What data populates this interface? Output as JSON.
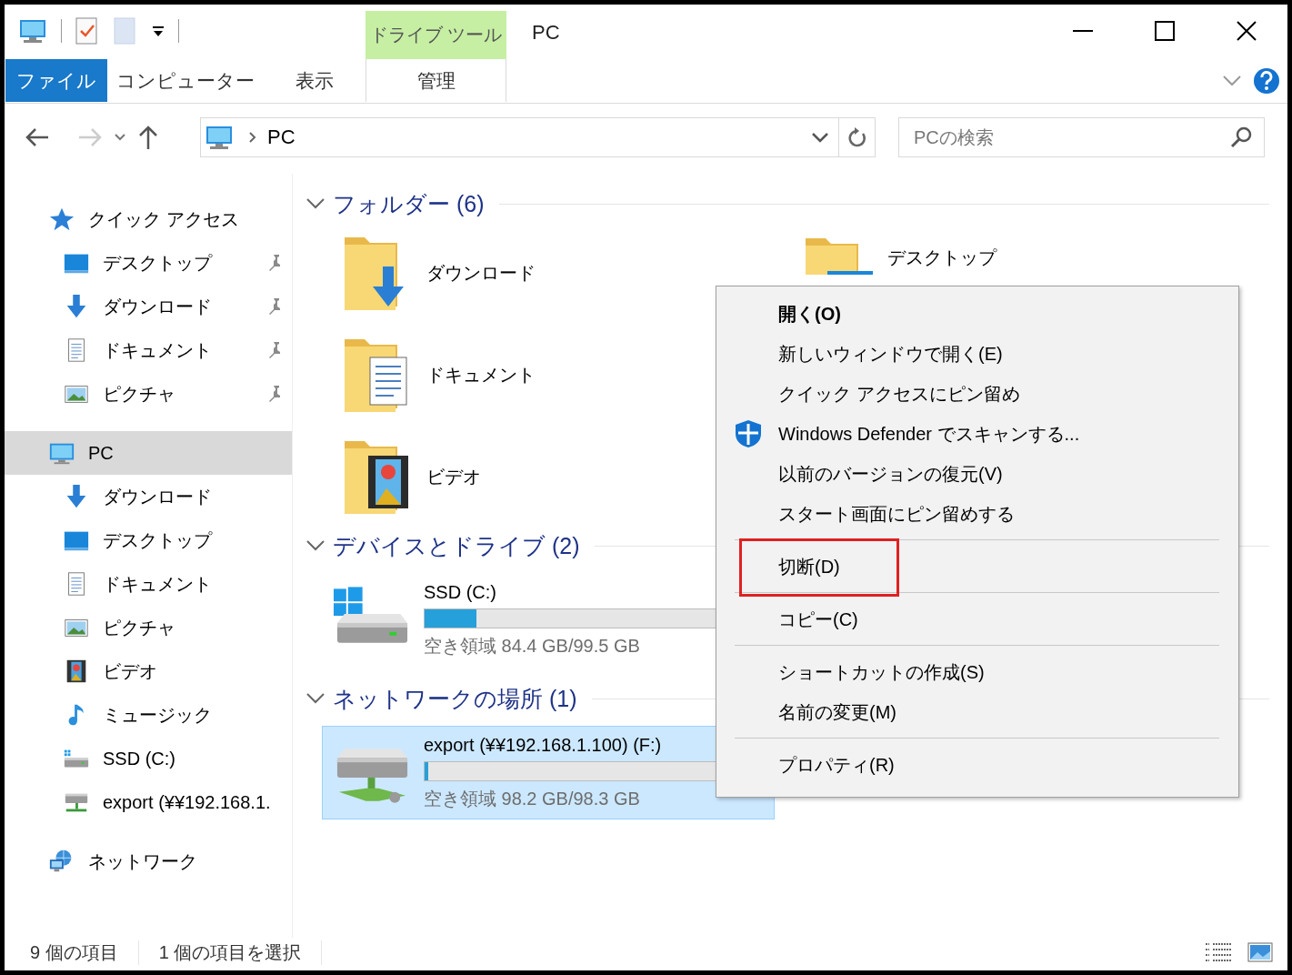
{
  "window": {
    "title": "PC"
  },
  "ribbon": {
    "context_group": "ドライブ ツール",
    "tabs": [
      {
        "label": "ファイル",
        "kind": "file",
        "selected": false
      },
      {
        "label": "コンピューター",
        "kind": "tab",
        "selected": false
      },
      {
        "label": "表示",
        "kind": "tab",
        "selected": false
      },
      {
        "label": "管理",
        "kind": "context",
        "selected": false
      }
    ]
  },
  "address": {
    "path": "PC"
  },
  "search": {
    "placeholder": "PCの検索"
  },
  "sidebar": {
    "items": [
      {
        "label": "クイック アクセス",
        "kind": "star",
        "selected": false,
        "children": [
          {
            "label": "デスクトップ",
            "kind": "desktop",
            "pinned": true,
            "selected": false
          },
          {
            "label": "ダウンロード",
            "kind": "download",
            "pinned": true,
            "selected": false
          },
          {
            "label": "ドキュメント",
            "kind": "document",
            "pinned": true,
            "selected": false
          },
          {
            "label": "ピクチャ",
            "kind": "picture",
            "pinned": true,
            "selected": false
          }
        ]
      },
      {
        "label": "PC",
        "kind": "pc",
        "selected": true,
        "children": [
          {
            "label": "ダウンロード",
            "kind": "download",
            "pinned": false,
            "selected": false
          },
          {
            "label": "デスクトップ",
            "kind": "desktop",
            "pinned": false,
            "selected": false
          },
          {
            "label": "ドキュメント",
            "kind": "document",
            "pinned": false,
            "selected": false
          },
          {
            "label": "ピクチャ",
            "kind": "picture",
            "pinned": false,
            "selected": false
          },
          {
            "label": "ビデオ",
            "kind": "video",
            "pinned": false,
            "selected": false
          },
          {
            "label": "ミュージック",
            "kind": "music",
            "pinned": false,
            "selected": false
          },
          {
            "label": "SSD (C:)",
            "kind": "drive",
            "pinned": false,
            "selected": false
          },
          {
            "label": "export (¥¥192.168.1.",
            "kind": "netdrive",
            "pinned": false,
            "selected": false
          }
        ]
      },
      {
        "label": "ネットワーク",
        "kind": "network",
        "selected": false
      }
    ]
  },
  "sections": [
    {
      "title": "フォルダー (6)",
      "kind": "folders",
      "items": [
        {
          "name": "ダウンロード",
          "kind": "download"
        },
        {
          "name": "デスクトップ",
          "kind": "desktop"
        },
        {
          "name": "ドキュメント",
          "kind": "document"
        },
        {
          "name": "ビデオ",
          "kind": "video"
        }
      ]
    },
    {
      "title": "デバイスとドライブ (2)",
      "kind": "drives",
      "items": [
        {
          "name": "SSD (C:)",
          "kind": "drive",
          "level": 0.15,
          "free": "空き領域 84.4 GB/99.5 GB",
          "selected": false
        }
      ]
    },
    {
      "title": "ネットワークの場所 (1)",
      "kind": "drives",
      "items": [
        {
          "name": "export (¥¥192.168.1.100) (F:)",
          "kind": "netdrive",
          "level": 0.01,
          "free": "空き領域 98.2 GB/98.3 GB",
          "selected": true
        }
      ]
    }
  ],
  "status_bar": {
    "items": [
      "9 個の項目",
      "1 個の項目を選択"
    ]
  },
  "context_menu": {
    "groups": [
      [
        {
          "label": "開く(O)",
          "kind": "command",
          "default": true,
          "highlighted": false
        },
        {
          "label": "新しいウィンドウで開く(E)",
          "kind": "command",
          "default": false,
          "highlighted": false
        },
        {
          "label": "クイック アクセスにピン留め",
          "kind": "command",
          "default": false,
          "highlighted": false
        },
        {
          "label": "Windows Defender でスキャンする...",
          "kind": "scan",
          "default": false,
          "highlighted": false
        },
        {
          "label": "以前のバージョンの復元(V)",
          "kind": "command",
          "default": false,
          "highlighted": false
        },
        {
          "label": "スタート画面にピン留めする",
          "kind": "command",
          "default": false,
          "highlighted": false
        }
      ],
      [
        {
          "label": "切断(D)",
          "kind": "command",
          "default": false,
          "highlighted": true
        }
      ],
      [
        {
          "label": "コピー(C)",
          "kind": "command",
          "default": false,
          "highlighted": false
        }
      ],
      [
        {
          "label": "ショートカットの作成(S)",
          "kind": "command",
          "default": false,
          "highlighted": false
        },
        {
          "label": "名前の変更(M)",
          "kind": "command",
          "default": false,
          "highlighted": false
        }
      ],
      [
        {
          "label": "プロパティ(R)",
          "kind": "command",
          "default": false,
          "highlighted": false
        }
      ]
    ]
  }
}
